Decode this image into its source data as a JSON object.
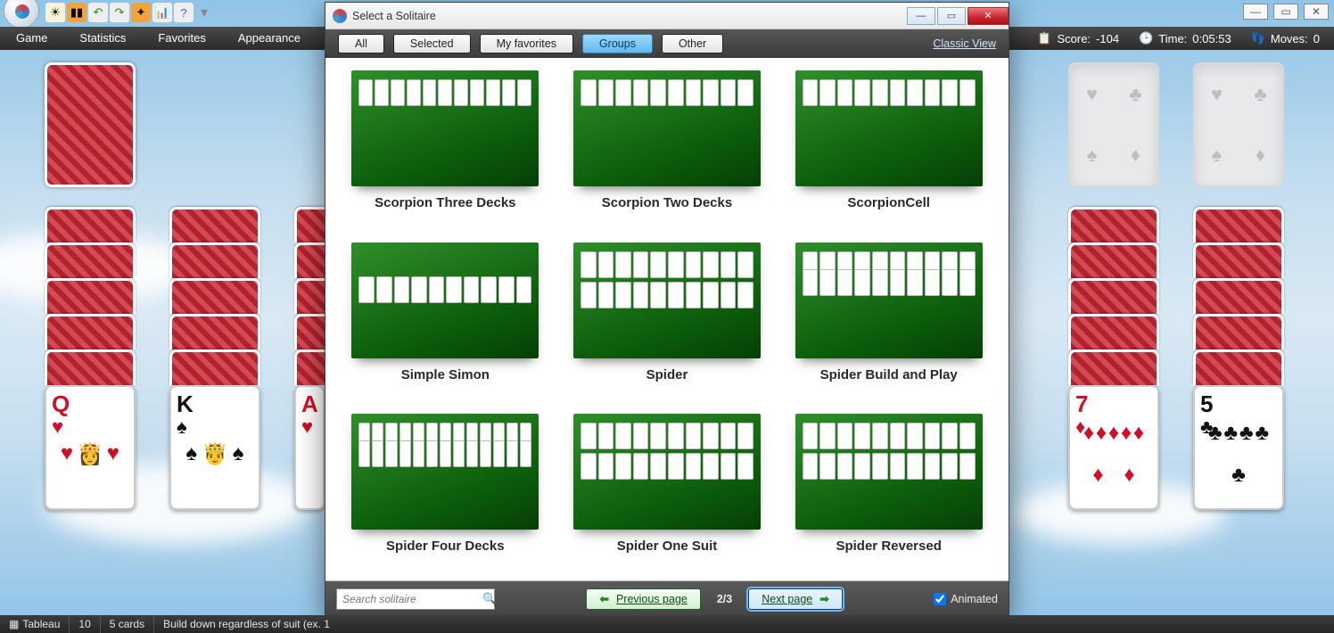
{
  "menus": {
    "game": "Game",
    "statistics": "Statistics",
    "favorites": "Favorites",
    "appearance": "Appearance"
  },
  "stats": {
    "score_label": "Score:",
    "score_value": "-104",
    "time_label": "Time:",
    "time_value": "0:05:53",
    "moves_label": "Moves:",
    "moves_value": "0"
  },
  "cards": {
    "pile1_rank": "Q",
    "pile1_suit": "♥",
    "pile2_rank": "K",
    "pile2_suit": "♠",
    "pile3_rank": "A",
    "pile3_suit": "♥",
    "piler1_rank": "7",
    "piler1_suit": "♦",
    "piler2_rank": "5",
    "piler2_suit": "♣"
  },
  "foundation_glyphs": {
    "heart": "♥",
    "club": "♣",
    "spade": "♠",
    "diamond": "♦"
  },
  "dialog": {
    "title": "Select a Solitaire",
    "tabs": {
      "all": "All",
      "selected": "Selected",
      "myfav": "My favorites",
      "groups": "Groups",
      "other": "Other"
    },
    "classic_view": "Classic View",
    "games": [
      "Scorpion Three Decks",
      "Scorpion Two Decks",
      "ScorpionCell",
      "Simple Simon",
      "Spider",
      "Spider Build and Play",
      "Spider Four Decks",
      "Spider One Suit",
      "Spider Reversed"
    ],
    "search_placeholder": "Search solitaire",
    "prev": "Previous page",
    "next": "Next page",
    "page": "2/3",
    "animated": "Animated"
  },
  "statusbar": {
    "area": "Tableau",
    "num": "10",
    "cards": "5 cards",
    "hint": "Build down regardless of suit (ex. 1"
  }
}
